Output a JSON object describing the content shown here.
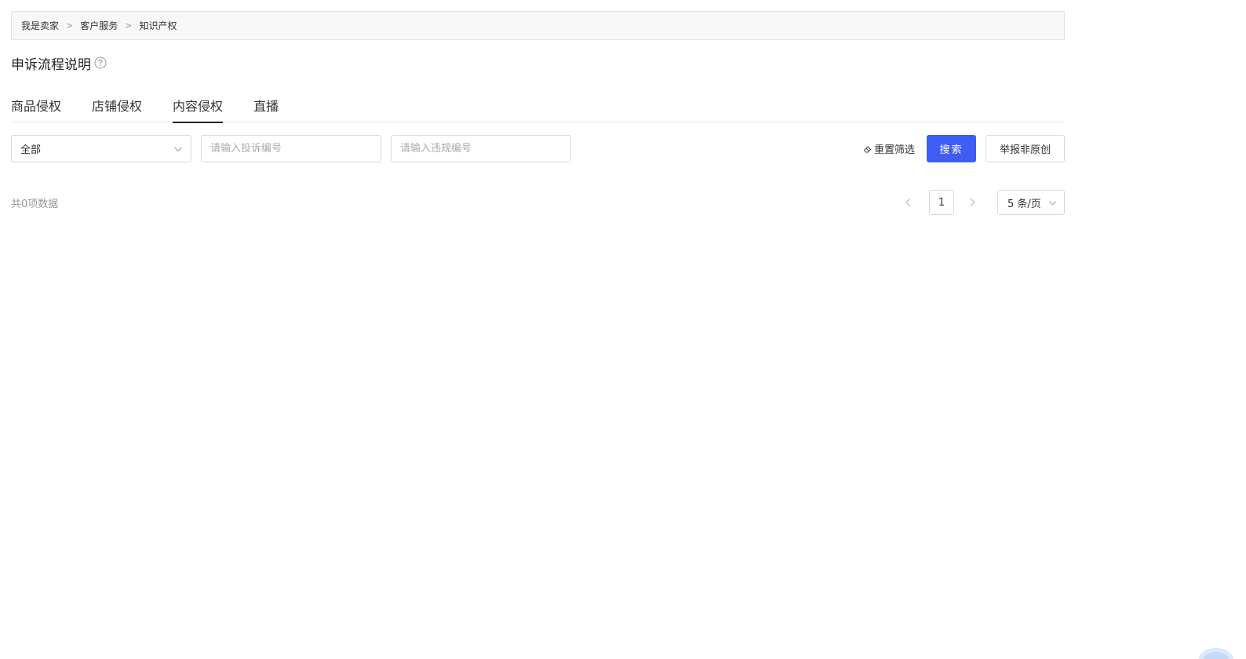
{
  "breadcrumb": {
    "items": [
      "我是卖家",
      "客户服务",
      "知识产权"
    ],
    "separator": ">"
  },
  "page": {
    "title": "申诉流程说明",
    "help_icon": "question-circle-icon"
  },
  "tabs": [
    {
      "label": "商品侵权",
      "active": false
    },
    {
      "label": "店铺侵权",
      "active": false
    },
    {
      "label": "内容侵权",
      "active": true
    },
    {
      "label": "直播",
      "active": false
    }
  ],
  "filters": {
    "status_select": {
      "value": "全部"
    },
    "complaint_input": {
      "placeholder": "请输入投诉编号",
      "value": ""
    },
    "violation_input": {
      "placeholder": "请输入违规编号",
      "value": ""
    },
    "reset_label": "重置筛选",
    "search_label": "搜索",
    "report_label": "举报非原创"
  },
  "list": {
    "total_text": "共0项数据"
  },
  "pagination": {
    "current_page": "1",
    "page_size_label": "5 条/页"
  },
  "colors": {
    "primary": "#3f5cf5",
    "breadcrumb_bg": "#f8f8f8",
    "border": "#d9d9d9"
  }
}
